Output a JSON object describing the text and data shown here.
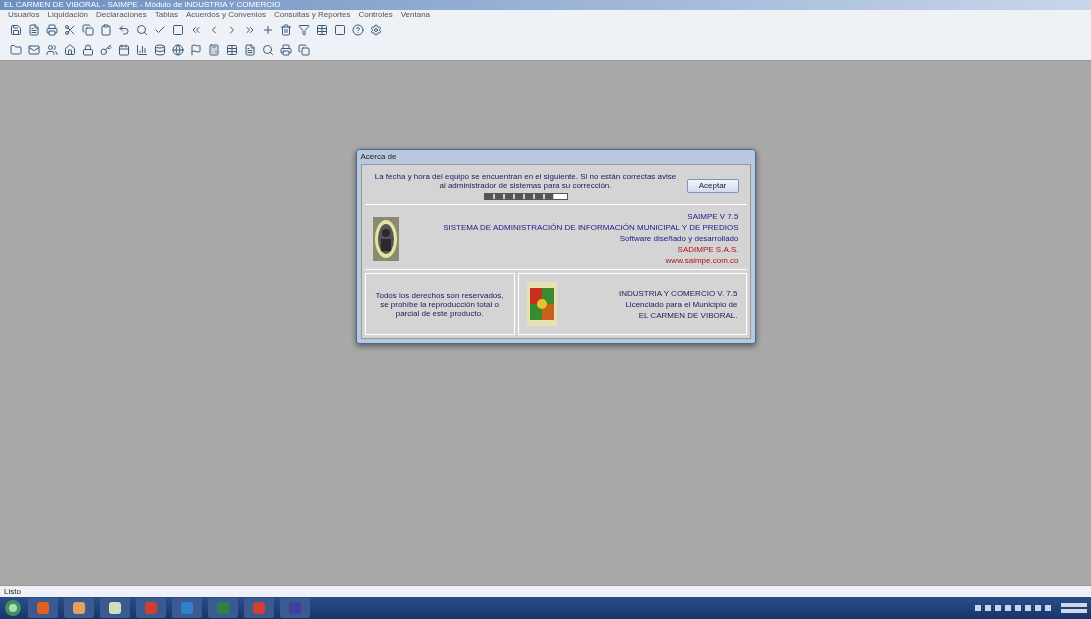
{
  "window": {
    "title": "EL CARMEN DE VIBORAL - SAIMPE - Módulo de INDUSTRIA Y COMERCIO"
  },
  "menu": [
    "Usuarios",
    "Liquidación",
    "Declaraciones",
    "Tablas",
    "Acuerdos y Convenios",
    "Consultas y Reportes",
    "Controles",
    "Ventana"
  ],
  "dialog": {
    "title": "Acerca de",
    "message": "La fecha y hora del equipo se encuentran en el siguiente. Si no están correctas avise al administrador de sistemas para su corrección.",
    "progress": {
      "level": 0.85
    },
    "ok_button": "Aceptar",
    "vendor_lines": [
      {
        "text": "SAIMPE V 7.5",
        "highlight": false
      },
      {
        "text": "SISTEMA DE ADMINISTRACIÓN DE INFORMACIÓN MUNICIPAL Y DE PREDIOS",
        "highlight": false
      },
      {
        "text": "Software diseñado y desarrollado",
        "highlight": false
      },
      {
        "text": "SADIMPE S.A.S.",
        "highlight": true
      },
      {
        "text": "www.saimpe.com.co",
        "highlight": true
      }
    ],
    "rights": "Todos los derechos son reservados, se prohíbe la reproducción total o parcial de este producto.",
    "license_lines": [
      "INDUSTRIA Y COMERCIO V. 7.5",
      "Licenciado para el Municipio de",
      "EL CARMEN DE VIBORAL."
    ]
  },
  "status_bar": "Listo"
}
